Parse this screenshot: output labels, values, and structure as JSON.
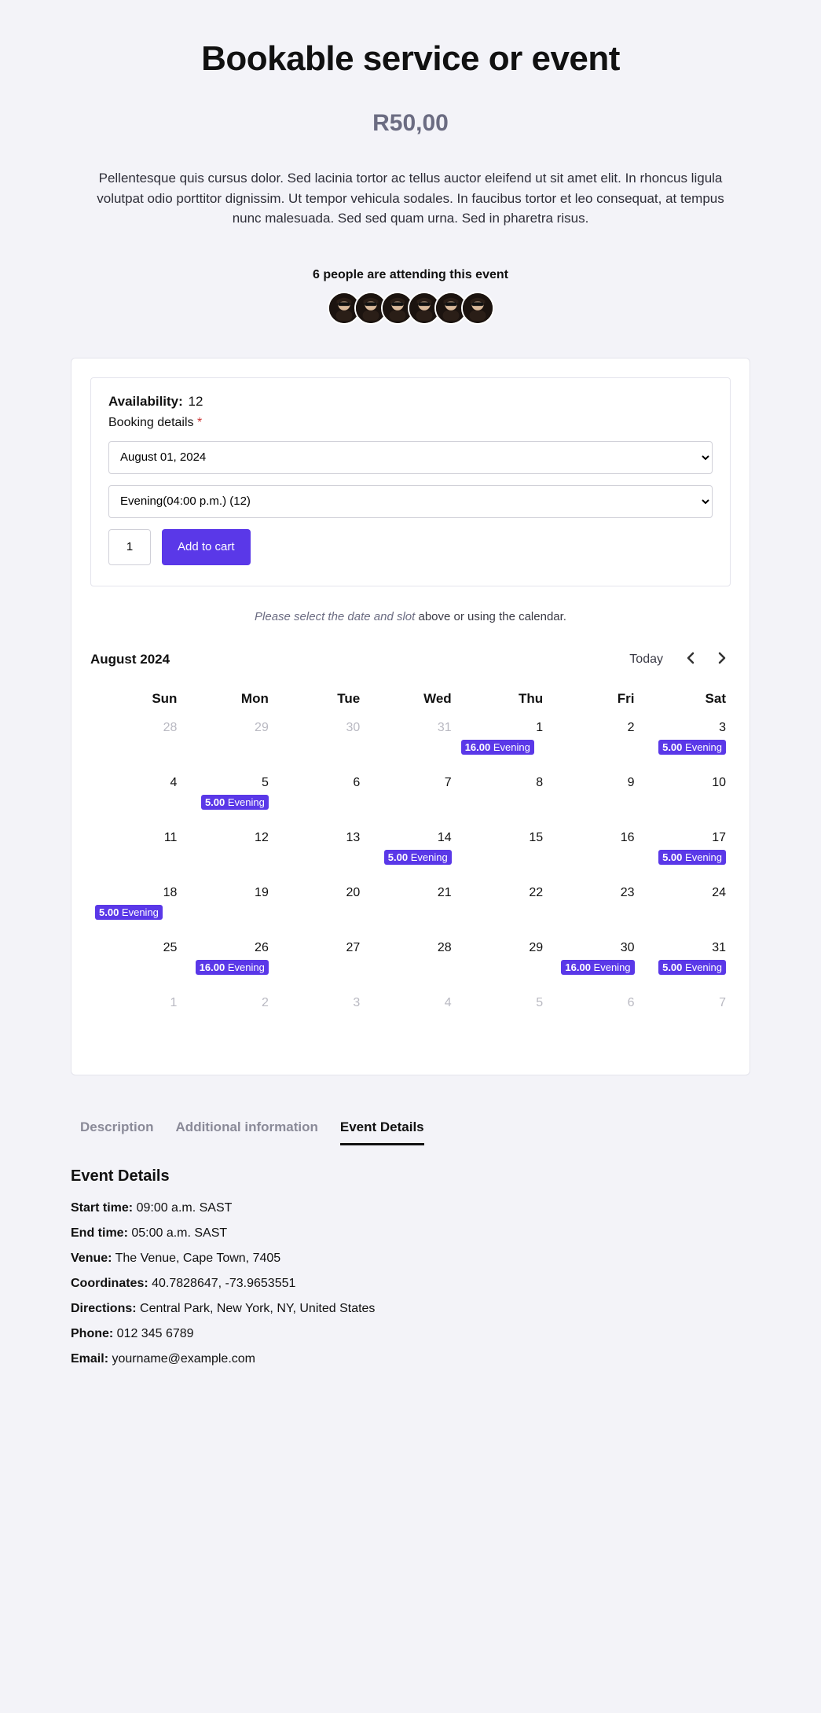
{
  "title": "Bookable service or event",
  "price": "R50,00",
  "description": "Pellentesque quis cursus dolor. Sed lacinia tortor ac tellus auctor eleifend ut sit amet elit. In rhoncus ligula volutpat odio porttitor dignissim. Ut tempor vehicula sodales. In faucibus tortor et leo consequat, at tempus nunc malesuada. Sed sed quam urna. Sed in pharetra risus.",
  "attending_text": "6 people are attending this event",
  "booking": {
    "availability_label": "Availability:",
    "availability_count": "12",
    "details_label": "Booking details",
    "date_option": "August 01, 2024",
    "slot_option": "Evening(04:00 p.m.) (12)",
    "qty": "1",
    "add_to_cart": "Add to cart"
  },
  "hint": {
    "em": "Please select the date and slot",
    "rest": " above or using the calendar."
  },
  "calendar": {
    "month": "August 2024",
    "today": "Today",
    "headers": [
      "Sun",
      "Mon",
      "Tue",
      "Wed",
      "Thu",
      "Fri",
      "Sat"
    ],
    "weeks": [
      [
        {
          "n": "28",
          "muted": true
        },
        {
          "n": "29",
          "muted": true
        },
        {
          "n": "30",
          "muted": true
        },
        {
          "n": "31",
          "muted": true
        },
        {
          "n": "1",
          "slot": {
            "time": "16.00",
            "label": "Evening",
            "align": "left"
          }
        },
        {
          "n": "2"
        },
        {
          "n": "3",
          "slot": {
            "time": "5.00",
            "label": "Evening",
            "align": "right"
          }
        }
      ],
      [
        {
          "n": "4"
        },
        {
          "n": "5",
          "slot": {
            "time": "5.00",
            "label": "Evening",
            "align": "right"
          }
        },
        {
          "n": "6"
        },
        {
          "n": "7"
        },
        {
          "n": "8"
        },
        {
          "n": "9"
        },
        {
          "n": "10"
        }
      ],
      [
        {
          "n": "11"
        },
        {
          "n": "12"
        },
        {
          "n": "13"
        },
        {
          "n": "14",
          "slot": {
            "time": "5.00",
            "label": "Evening",
            "align": "right"
          }
        },
        {
          "n": "15"
        },
        {
          "n": "16"
        },
        {
          "n": "17",
          "slot": {
            "time": "5.00",
            "label": "Evening",
            "align": "right"
          }
        }
      ],
      [
        {
          "n": "18",
          "slot": {
            "time": "5.00",
            "label": "Evening",
            "align": "left"
          }
        },
        {
          "n": "19"
        },
        {
          "n": "20"
        },
        {
          "n": "21"
        },
        {
          "n": "22"
        },
        {
          "n": "23"
        },
        {
          "n": "24"
        }
      ],
      [
        {
          "n": "25"
        },
        {
          "n": "26",
          "slot": {
            "time": "16.00",
            "label": "Evening",
            "align": "right"
          }
        },
        {
          "n": "27"
        },
        {
          "n": "28"
        },
        {
          "n": "29"
        },
        {
          "n": "30",
          "slot": {
            "time": "16.00",
            "label": "Evening",
            "align": "right"
          }
        },
        {
          "n": "31",
          "slot": {
            "time": "5.00",
            "label": "Evening",
            "align": "right"
          }
        }
      ],
      [
        {
          "n": "1",
          "muted": true
        },
        {
          "n": "2",
          "muted": true
        },
        {
          "n": "3",
          "muted": true
        },
        {
          "n": "4",
          "muted": true
        },
        {
          "n": "5",
          "muted": true
        },
        {
          "n": "6",
          "muted": true
        },
        {
          "n": "7",
          "muted": true
        }
      ]
    ]
  },
  "tabs": {
    "description": "Description",
    "additional": "Additional information",
    "event": "Event Details"
  },
  "details": {
    "heading": "Event Details",
    "start_label": "Start time:",
    "start_value": " 09:00 a.m. SAST",
    "end_label": "End time:",
    "end_value": " 05:00 a.m. SAST",
    "venue_label": "Venue:",
    "venue_value": " The Venue, Cape Town, 7405",
    "coord_label": "Coordinates:",
    "coord_value": " 40.7828647, -73.9653551",
    "dir_label": "Directions:",
    "dir_value": " Central Park, New York, NY, United States",
    "phone_label": "Phone:",
    "phone_value": " 012 345 6789",
    "email_label": "Email:",
    "email_value": " yourname@example.com"
  }
}
